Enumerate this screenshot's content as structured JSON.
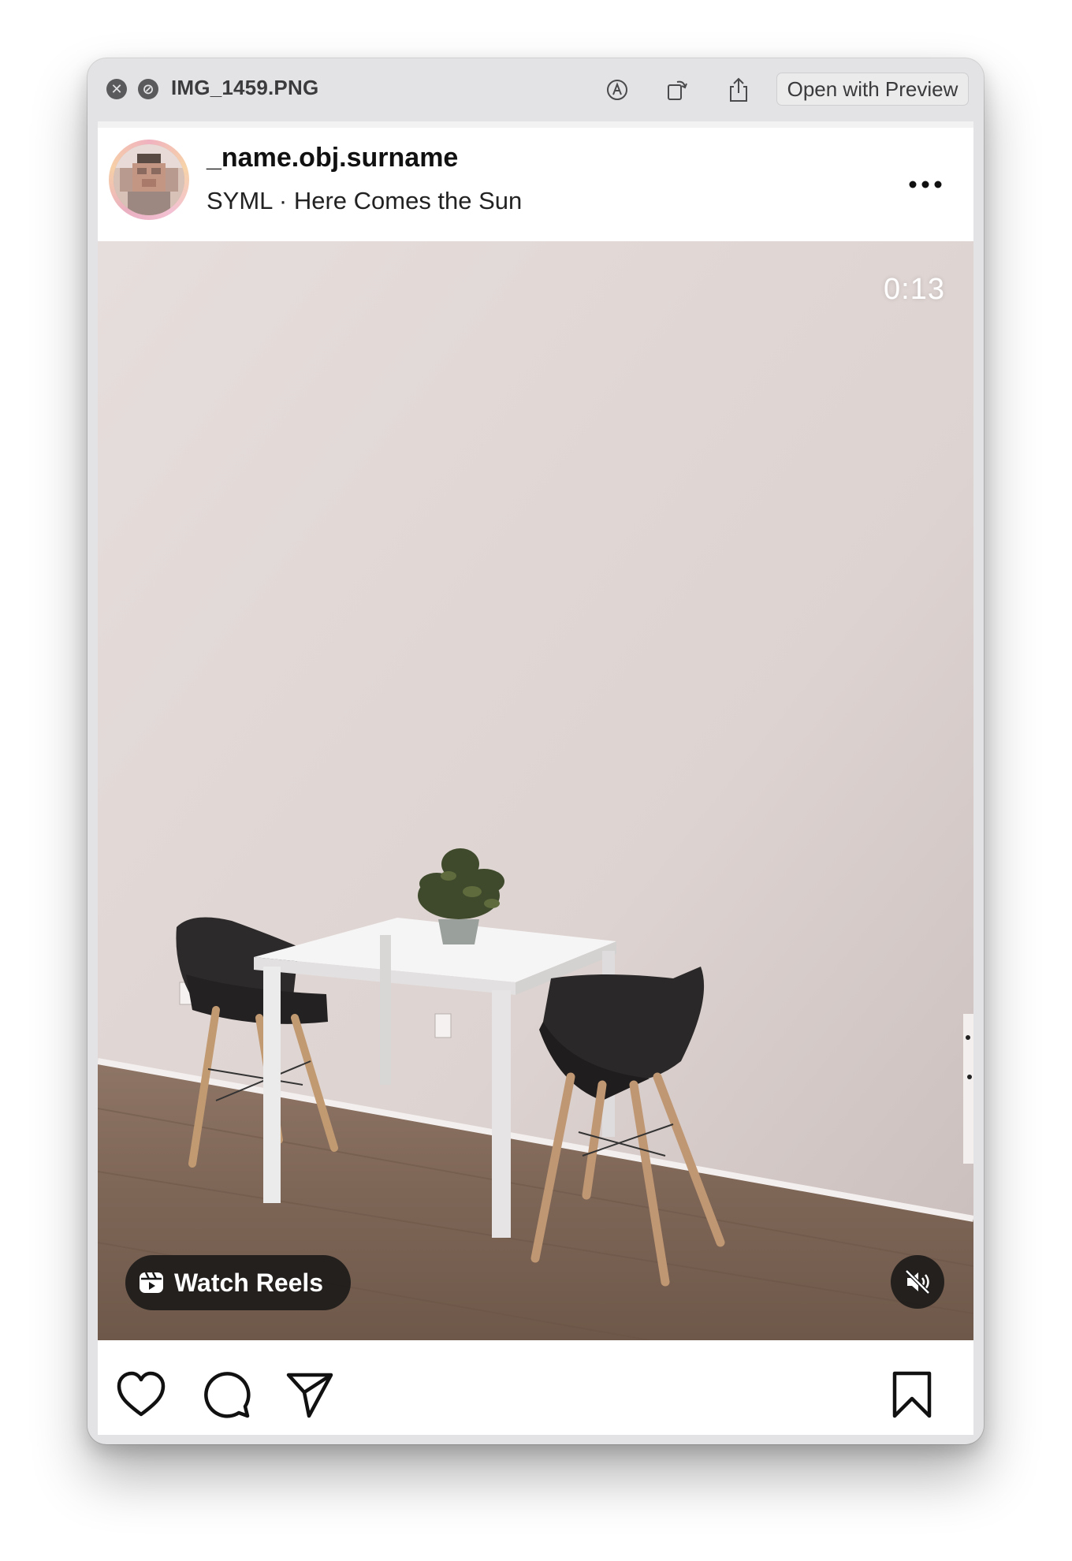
{
  "window": {
    "title": "IMG_1459.PNG",
    "open_with_label": "Open with Preview",
    "close_icon": "close-icon",
    "fullscreen_icon": "fullscreen-icon",
    "toolbar_icons": [
      "markup-icon",
      "rotate-icon",
      "share-icon"
    ]
  },
  "post": {
    "username": "_name.obj.surname",
    "subtitle": "SYML · Here Comes the Sun",
    "more_icon": "more-options-icon",
    "video": {
      "timer": "0:13",
      "watch_reels_label": "Watch Reels",
      "mute_icon": "muted-speaker-icon"
    },
    "actions": {
      "like_icon": "heart-icon",
      "comment_icon": "comment-icon",
      "share_icon": "send-icon",
      "save_icon": "bookmark-icon"
    }
  }
}
